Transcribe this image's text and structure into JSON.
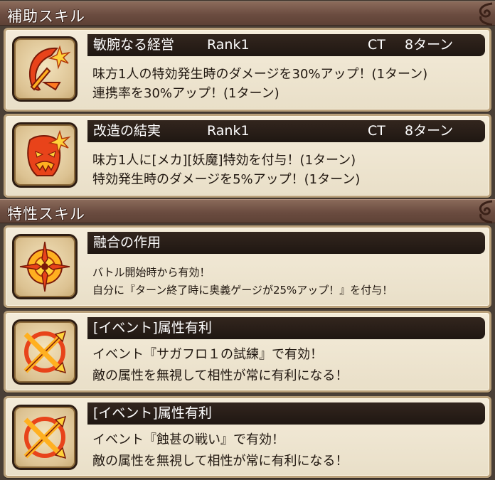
{
  "sections": {
    "support": "補助スキル",
    "trait": "特性スキル"
  },
  "support_skills": [
    {
      "icon": "crescent-slash-icon",
      "name": "敏腕なる経営",
      "rank": "Rank1",
      "ct": "CT",
      "turns": "8ターン",
      "lines": [
        "味方1人の特効発生時のダメージを30%アップ！(1ターン)",
        "連携率を30%アップ！(1ターン)"
      ]
    },
    {
      "icon": "demon-mask-icon",
      "name": "改造の結実",
      "rank": "Rank1",
      "ct": "CT",
      "turns": "8ターン",
      "lines": [
        "味方1人に[メカ][妖魔]特効を付与！(1ターン)",
        "特効発生時のダメージを5%アップ！(1ターン)"
      ]
    }
  ],
  "trait_skills": [
    {
      "icon": "compass-star-icon",
      "name": "融合の作用",
      "lines": [
        "バトル開始時から有効！",
        "自分に『ターン終了時に奥義ゲージが25%アップ！』を付与！"
      ]
    },
    {
      "icon": "crossed-arrows-icon",
      "name": "[イベント]属性有利",
      "lines": [
        "イベント『サガフロ１の試練』で有効！",
        "敵の属性を無視して相性が常に有利になる！"
      ]
    },
    {
      "icon": "crossed-arrows-icon",
      "name": "[イベント]属性有利",
      "lines": [
        "イベント『蝕甚の戦い』で有効！",
        "敵の属性を無視して相性が常に有利になる！"
      ]
    }
  ],
  "colors": {
    "background": "#4a3f36",
    "header": "#6b4c40",
    "card": "#f1e8d4",
    "name_bar": "#2a1f18",
    "icon_fire": "#e8431a",
    "icon_glow": "#ffd23a"
  }
}
